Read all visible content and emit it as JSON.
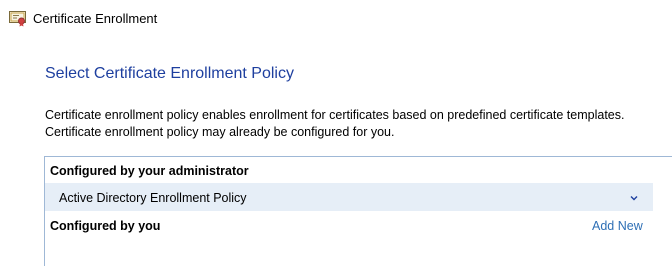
{
  "window": {
    "title": "Certificate Enrollment",
    "icon": "certificate-icon"
  },
  "page": {
    "title": "Select Certificate Enrollment Policy",
    "description_line1": "Certificate enrollment policy enables enrollment for certificates based on predefined certificate templates.",
    "description_line2": "Certificate enrollment policy may already be configured for you."
  },
  "sections": {
    "administrator": {
      "title": "Configured by your administrator",
      "policies": [
        {
          "label": "Active Directory Enrollment Policy",
          "icon": "chevron-down-icon"
        }
      ]
    },
    "user": {
      "title": "Configured by you",
      "action_label": "Add New"
    }
  },
  "colors": {
    "title_blue": "#1e3f9f",
    "link_blue": "#2e6fb5",
    "row_highlight": "#e6eef7",
    "panel_border": "#9fb8d6"
  }
}
